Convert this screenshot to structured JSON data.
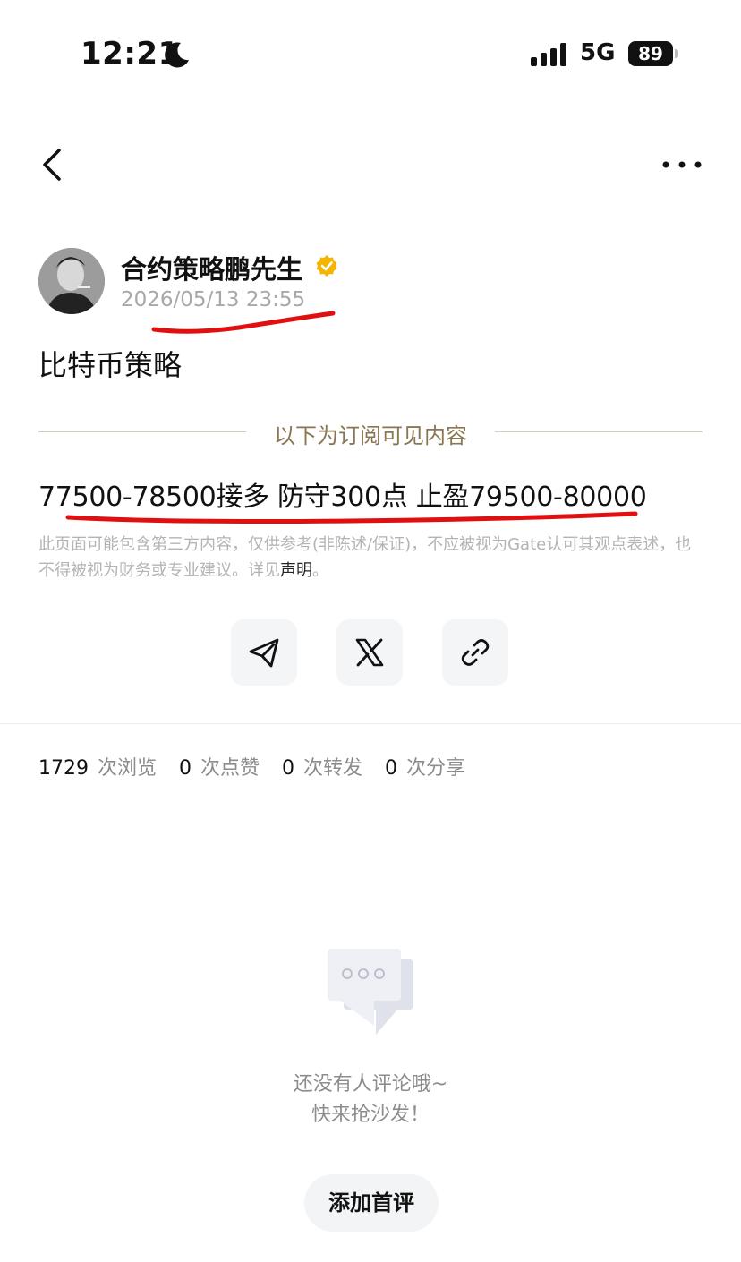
{
  "status_bar": {
    "time": "12:21",
    "network": "5G",
    "battery": "89",
    "icons": [
      "moon-icon",
      "signal-icon",
      "battery-icon"
    ]
  },
  "nav": {
    "back_icon": "chevron-left-icon",
    "more_icon": "more-dots-icon"
  },
  "author": {
    "name": "合约策略鹏先生",
    "badge_icon": "verified-badge-icon",
    "badge_color": "#F5B400",
    "date": "2026/05/13 23:55"
  },
  "post": {
    "title": "比特币策略",
    "subscription_label": "以下为订阅可见内容",
    "strategy_text": "77500-78500接多 防守300点 止盈79500-80000",
    "annotation_color": "#E01010"
  },
  "disclaimer": {
    "text": "此页面可能包含第三方内容，仅供参考(非陈述/保证)，不应被视为Gate认可其观点表述，也不得被视为财务或专业建议。详见",
    "link_text": "声明",
    "end": "。"
  },
  "share": {
    "buttons": [
      {
        "icon": "telegram-icon"
      },
      {
        "icon": "x-icon"
      },
      {
        "icon": "link-icon"
      }
    ]
  },
  "stats": {
    "views": "1729",
    "views_label": "次浏览",
    "likes": "0",
    "likes_label": "次点赞",
    "reposts": "0",
    "reposts_label": "次转发",
    "shares": "0",
    "shares_label": "次分享"
  },
  "comments": {
    "empty_icon": "comment-bubble-icon",
    "empty_line1": "还没有人评论哦~",
    "empty_line2": "快来抢沙发！",
    "add_button": "添加首评"
  }
}
